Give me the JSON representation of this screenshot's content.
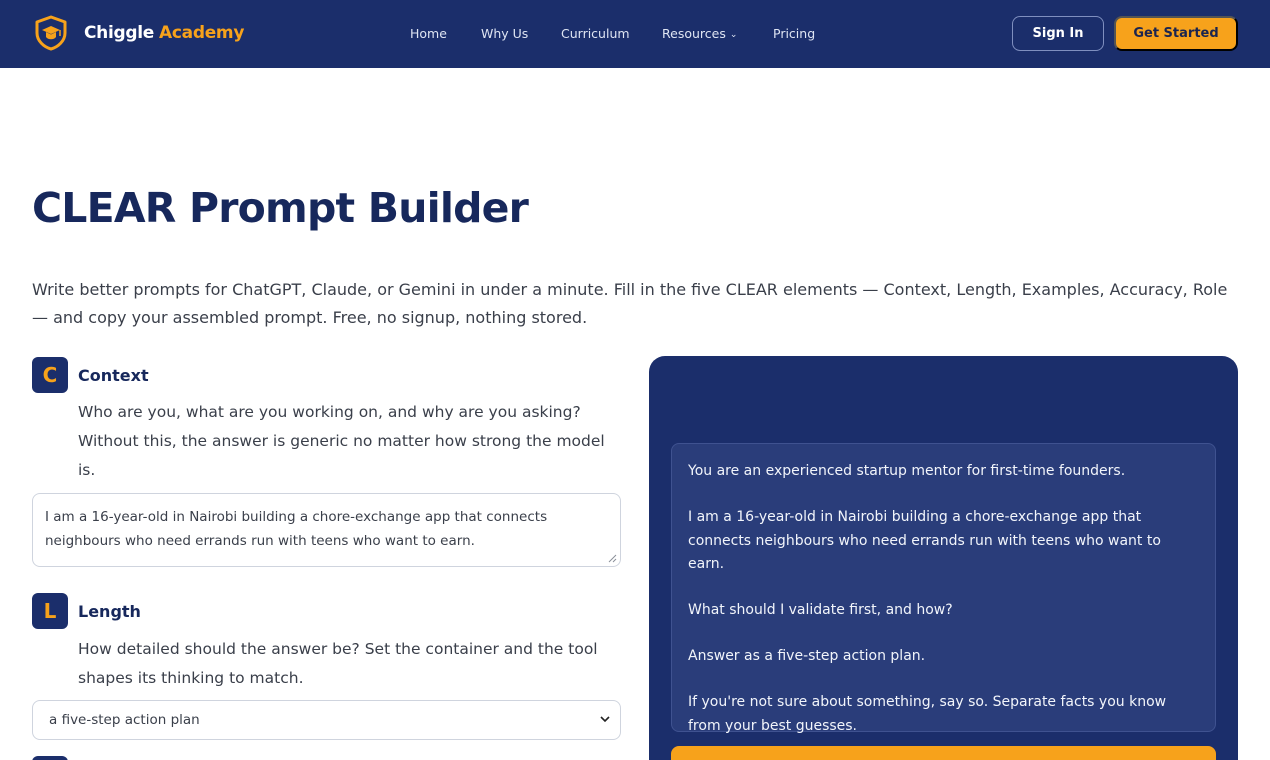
{
  "nav": {
    "brand_primary": "Chiggle",
    "brand_secondary": "Academy",
    "items": [
      {
        "label": "Home"
      },
      {
        "label": "Why Us"
      },
      {
        "label": "Curriculum"
      },
      {
        "label": "Resources",
        "caret": "⌄"
      },
      {
        "label": "Pricing"
      }
    ],
    "sign_in": "Sign In",
    "get_started": "Get Started"
  },
  "page": {
    "title": "CLEAR Prompt Builder",
    "intro": "Write better prompts for ChatGPT, Claude, or Gemini in under a minute. Fill in the five CLEAR elements — Context, Length, Examples, Accuracy, Role — and copy your assembled prompt. Free, no signup, nothing stored."
  },
  "sections": {
    "context": {
      "letter": "C",
      "title": "Context",
      "description": "Who are you, what are you working on, and why are you asking? Without this, the answer is generic no matter how strong the model is.",
      "value": "I am a 16-year-old in Nairobi building a chore-exchange app that connects neighbours who need errands run with teens who want to earn."
    },
    "length": {
      "letter": "L",
      "title": "Length",
      "description": "How detailed should the answer be? Set the container and the tool shapes its thinking to match.",
      "selected": "a five-step action plan"
    }
  },
  "output": {
    "lines": [
      "You are an experienced startup mentor for first-time founders.",
      "I am a 16-year-old in Nairobi building a chore-exchange app that connects neighbours who need errands run with teens who want to earn.",
      "What should I validate first, and how?",
      "Answer as a five-step action plan.",
      "If you're not sure about something, say so. Separate facts you know from your best guesses."
    ]
  },
  "colors": {
    "navy": "#1b2e6b",
    "accent": "#f7a21b",
    "output_bg": "#2a3d7a"
  },
  "icons": {
    "logo": "shield-graduation-cap-icon",
    "select_chevron": "chevron-down-icon",
    "resize": "resize-grip-icon"
  }
}
